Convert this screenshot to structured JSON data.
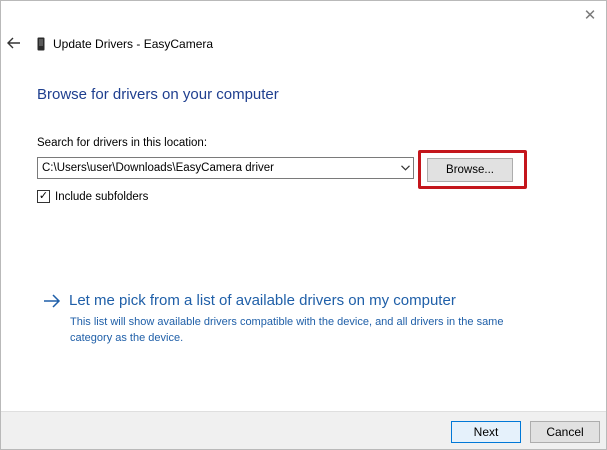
{
  "window": {
    "title": "Update Drivers - EasyCamera",
    "close_glyph": "✕"
  },
  "heading": "Browse for drivers on your computer",
  "search": {
    "label": "Search for drivers in this location:",
    "path_value": "C:\\Users\\user\\Downloads\\EasyCamera driver",
    "browse_label": "Browse..."
  },
  "subfolders": {
    "label": "Include subfolders",
    "checked": true,
    "check_glyph": "✓"
  },
  "pick": {
    "link": "Let me pick from a list of available drivers on my computer",
    "description": "This list will show available drivers compatible with the device, and all drivers in the same category as the device."
  },
  "footer": {
    "next_label": "Next",
    "cancel_label": "Cancel"
  },
  "colors": {
    "heading": "#1f3f8f",
    "link": "#1f5fa8",
    "highlight": "#c4161c",
    "primary_border": "#0078d7"
  },
  "icons": {
    "back": "back-arrow-icon",
    "device": "device-icon",
    "dropdown": "chevron-down-icon",
    "pick": "right-arrow-icon",
    "close": "close-icon"
  }
}
